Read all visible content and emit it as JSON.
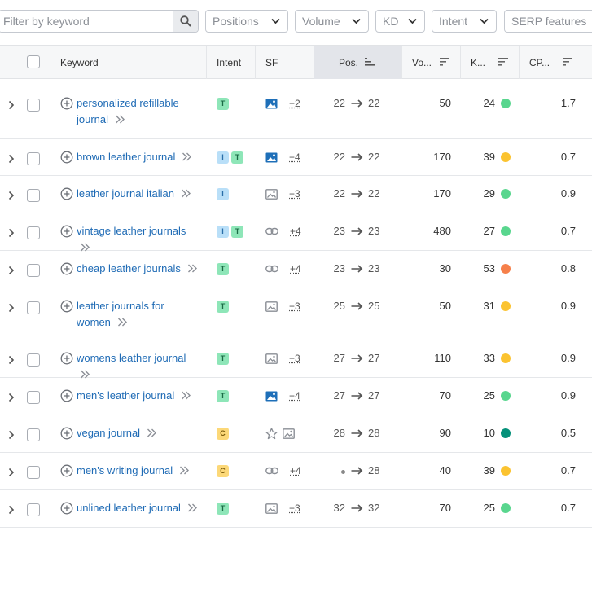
{
  "filters": {
    "search_placeholder": "Filter by keyword",
    "positions": "Positions",
    "volume": "Volume",
    "kd": "KD",
    "intent": "Intent",
    "serp": "SERP features"
  },
  "columns": {
    "keyword": "Keyword",
    "intent": "Intent",
    "sf": "SF",
    "pos": "Pos.",
    "volume": "Vo...",
    "kd": "K...",
    "cpc": "CP..."
  },
  "colors": {
    "kd_green": "#59d68e",
    "kd_yellow": "#fbc330",
    "kd_orange": "#f6804a",
    "kd_darkgreen": "#05917a"
  },
  "rows": [
    {
      "keyword": "personalized refillable journal",
      "intents": [
        "T"
      ],
      "sf_icons": [
        "image-icon"
      ],
      "sf_more": "+2",
      "pos_from": "22",
      "pos_to": "22",
      "volume": "50",
      "kd": "24",
      "kd_level": "green",
      "cpc": "1.7"
    },
    {
      "keyword": "brown leather journal",
      "intents": [
        "I",
        "T"
      ],
      "sf_icons": [
        "image-icon"
      ],
      "sf_more": "+4",
      "pos_from": "22",
      "pos_to": "22",
      "volume": "170",
      "kd": "39",
      "kd_level": "yellow",
      "cpc": "0.7"
    },
    {
      "keyword": "leather journal italian",
      "intents": [
        "I"
      ],
      "sf_icons": [
        "image-outline-icon"
      ],
      "sf_more": "+3",
      "pos_from": "22",
      "pos_to": "22",
      "volume": "170",
      "kd": "29",
      "kd_level": "green",
      "cpc": "0.9"
    },
    {
      "keyword": "vintage leather journals",
      "intents": [
        "I",
        "T"
      ],
      "sf_icons": [
        "link-icon"
      ],
      "sf_more": "+4",
      "pos_from": "23",
      "pos_to": "23",
      "volume": "480",
      "kd": "27",
      "kd_level": "green",
      "cpc": "0.7"
    },
    {
      "keyword": "cheap leather journals",
      "intents": [
        "T"
      ],
      "sf_icons": [
        "link-icon"
      ],
      "sf_more": "+4",
      "pos_from": "23",
      "pos_to": "23",
      "volume": "30",
      "kd": "53",
      "kd_level": "orange",
      "cpc": "0.8"
    },
    {
      "keyword": "leather journals for women",
      "intents": [
        "T"
      ],
      "sf_icons": [
        "image-outline-icon"
      ],
      "sf_more": "+3",
      "pos_from": "25",
      "pos_to": "25",
      "volume": "50",
      "kd": "31",
      "kd_level": "yellow",
      "cpc": "0.9"
    },
    {
      "keyword": "womens leather journal",
      "intents": [
        "T"
      ],
      "sf_icons": [
        "image-outline-icon"
      ],
      "sf_more": "+3",
      "pos_from": "27",
      "pos_to": "27",
      "volume": "110",
      "kd": "33",
      "kd_level": "yellow",
      "cpc": "0.9"
    },
    {
      "keyword": "men's leather journal",
      "intents": [
        "T"
      ],
      "sf_icons": [
        "image-icon"
      ],
      "sf_more": "+4",
      "pos_from": "27",
      "pos_to": "27",
      "volume": "70",
      "kd": "25",
      "kd_level": "green",
      "cpc": "0.9"
    },
    {
      "keyword": "vegan journal",
      "intents": [
        "C"
      ],
      "sf_icons": [
        "star-icon",
        "image-outline-icon"
      ],
      "sf_more": "",
      "pos_from": "28",
      "pos_to": "28",
      "volume": "90",
      "kd": "10",
      "kd_level": "darkgreen",
      "cpc": "0.5"
    },
    {
      "keyword": "men's writing journal",
      "intents": [
        "C"
      ],
      "sf_icons": [
        "link-icon"
      ],
      "sf_more": "+4",
      "pos_from": "",
      "pos_to": "28",
      "volume": "40",
      "kd": "39",
      "kd_level": "yellow",
      "cpc": "0.7"
    },
    {
      "keyword": "unlined leather journal",
      "intents": [
        "T"
      ],
      "sf_icons": [
        "image-outline-icon"
      ],
      "sf_more": "+3",
      "pos_from": "32",
      "pos_to": "32",
      "volume": "70",
      "kd": "25",
      "kd_level": "green",
      "cpc": "0.7"
    }
  ]
}
